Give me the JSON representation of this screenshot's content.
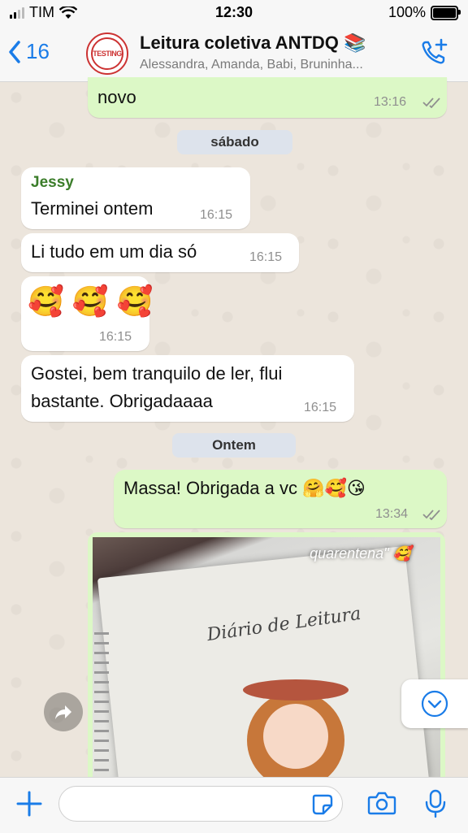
{
  "status_bar": {
    "carrier": "TIM",
    "time": "12:30",
    "battery": "100%"
  },
  "header": {
    "back_count": "16",
    "group_name": "Leitura coletiva ANTDQ 📚",
    "members": "Alessandra, Amanda, Babi, Bruninha..."
  },
  "messages": {
    "m0": {
      "text": "novo",
      "time": "13:16"
    },
    "day1": "sábado",
    "m1": {
      "sender": "Jessy",
      "text": "Terminei ontem",
      "time": "16:15"
    },
    "m2": {
      "text": "Li tudo em um dia só",
      "time": "16:15"
    },
    "m3": {
      "text": "🥰 🥰 🥰",
      "time": "16:15"
    },
    "m4": {
      "line1": "Gostei, bem tranquilo de ler, flui",
      "line2": "bastante. Obrigadaaaa",
      "time": "16:15"
    },
    "day2": "Ontem",
    "m5": {
      "text": "Massa! Obrigada a vc 🤗🥰😘",
      "time": "13:34"
    },
    "m6": {
      "photo_caption": "quarentena\" 🥰",
      "photo_cover_title": "Diário de Leitura"
    }
  },
  "composer": {
    "placeholder": ""
  },
  "colors": {
    "accent": "#1a7ce8",
    "outgoing_bubble": "#dcf8c6",
    "incoming_bubble": "#ffffff",
    "sender_name": "#3b7d2a"
  },
  "icons": [
    "chevron-left-icon",
    "add-call-icon",
    "double-check-icon",
    "forward-icon",
    "chevron-down-icon",
    "plus-icon",
    "sticker-icon",
    "camera-icon",
    "mic-icon"
  ]
}
